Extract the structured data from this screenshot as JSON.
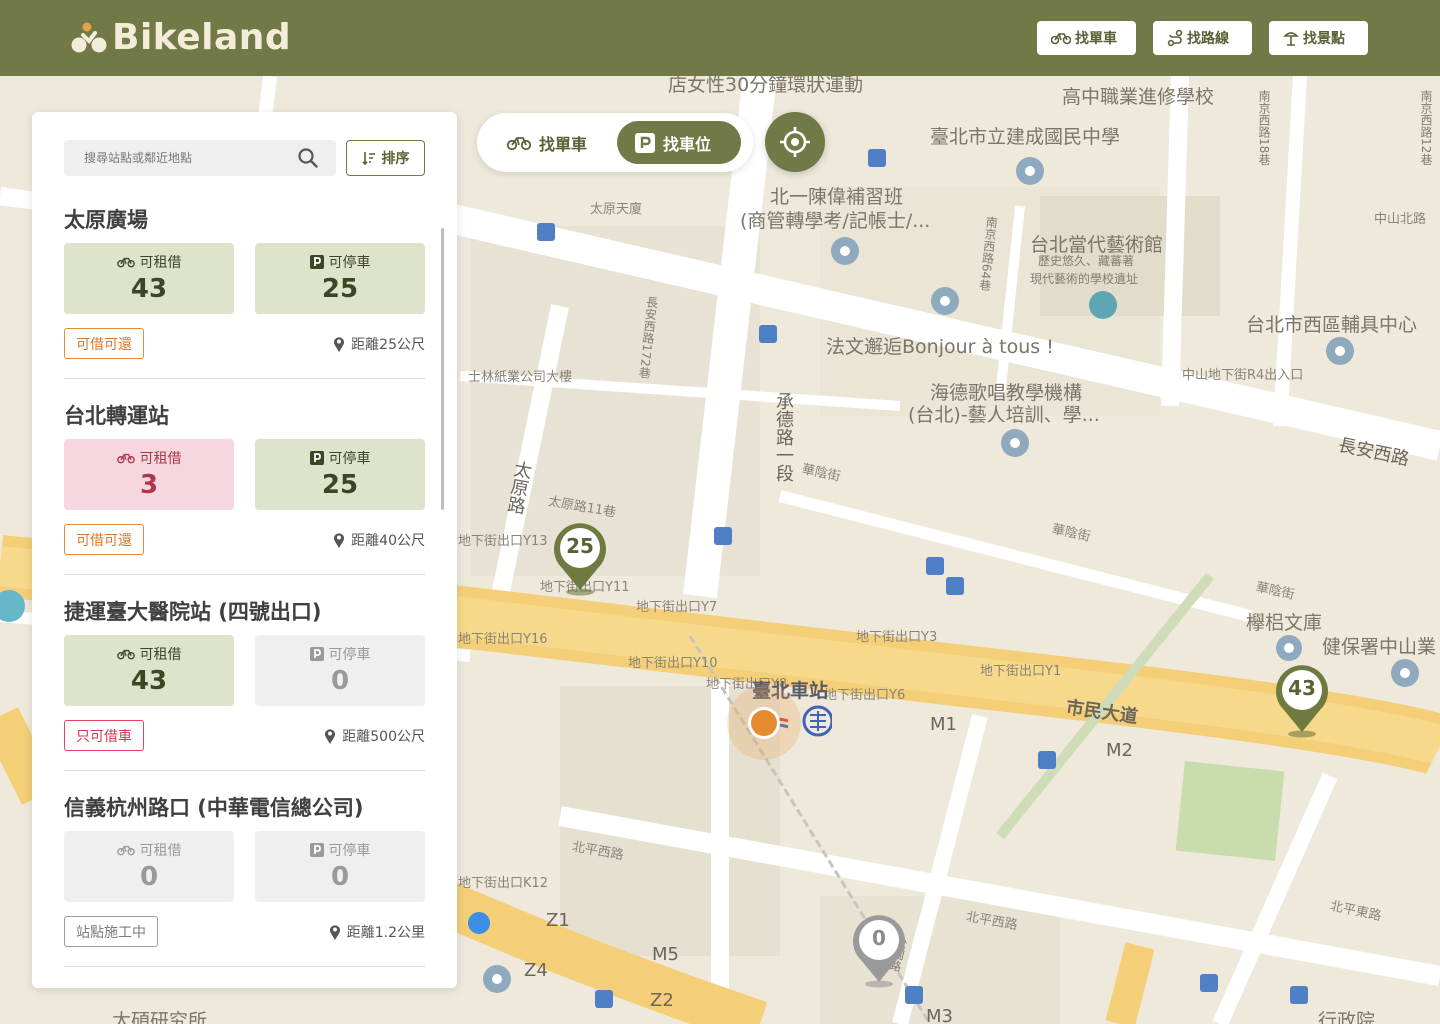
{
  "app": {
    "logo_text": "Bikeland",
    "nav": [
      {
        "label": "找單車",
        "icon": "bike-icon"
      },
      {
        "label": "找路線",
        "icon": "route-icon"
      },
      {
        "label": "找景點",
        "icon": "landmark-icon"
      }
    ]
  },
  "mode_toggle": {
    "options": [
      {
        "label": "找單車",
        "icon": "bike-icon",
        "active": false
      },
      {
        "label": "找車位",
        "icon": "parking-icon",
        "active": true
      }
    ],
    "locate_icon": "crosshair-icon"
  },
  "panel": {
    "search_placeholder": "搜尋站點或鄰近地點",
    "sort_label": "排序",
    "stations": [
      {
        "name": "太原廣場",
        "rent_label": "可租借",
        "rent": "43",
        "rent_state": "green",
        "park_label": "可停車",
        "park": "25",
        "park_state": "green",
        "tag": "可借可還",
        "tag_state": "orange",
        "distance": "距離25公尺"
      },
      {
        "name": "台北轉運站",
        "rent_label": "可租借",
        "rent": "3",
        "rent_state": "pink",
        "park_label": "可停車",
        "park": "25",
        "park_state": "green",
        "tag": "可借可還",
        "tag_state": "orange",
        "distance": "距離40公尺"
      },
      {
        "name": "捷運臺大醫院站 (四號出口)",
        "rent_label": "可租借",
        "rent": "43",
        "rent_state": "green",
        "park_label": "可停車",
        "park": "0",
        "park_state": "gray",
        "tag": "只可借車",
        "tag_state": "red",
        "distance": "距離500公尺"
      },
      {
        "name": "信義杭州路口 (中華電信總公司)",
        "rent_label": "可租借",
        "rent": "0",
        "rent_state": "gray",
        "park_label": "可停車",
        "park": "0",
        "park_state": "gray",
        "tag": "站點施工中",
        "tag_state": "gray",
        "distance": "距離1.2公里"
      }
    ]
  },
  "map": {
    "pins": [
      {
        "value": "25",
        "state": "green"
      },
      {
        "value": "43",
        "state": "green"
      },
      {
        "value": "0",
        "state": "gray"
      }
    ],
    "station_name": "臺北車站",
    "labels": {
      "l1": "店女性30分鐘環狀運動",
      "l2": "高中職業進修學校",
      "l3": "臺北市立建成國民中學",
      "l4": "北一陳偉補習班",
      "l5": "(商管轉學考/記帳士/...",
      "l6": "太原天廈",
      "l7": "台北當代藝術館",
      "l8": "歷史悠久、藏蕃著",
      "l9": "現代藝術的學校遺址",
      "l10": "法文邂逅Bonjour à tous !",
      "l11": "台北市西區輔具中心",
      "l12": "士林紙業公司大樓",
      "l13": "海德歌唱教學機構",
      "l14": "(台北)-藝人培訓、學...",
      "l15": "中山地下街R4出入口",
      "l16": "長安西路",
      "l17": "承德路一段",
      "l18": "華陰街",
      "l19": "華陰街",
      "l20": "太原路",
      "l21": "太原路11巷",
      "l22": "地下街出口Y13",
      "l23": "地下街出口Y11",
      "l24": "地下街出口Y7",
      "l25": "地下街出口Y16",
      "l26": "地下街出口Y10",
      "l27": "地下街出口Y8",
      "l28": "地下街出口Y6",
      "l29": "地下街出口Y3",
      "l30": "地下街出口Y1",
      "l31": "市民大道",
      "l32": "M1",
      "l33": "M2",
      "l34": "欅梠文庫",
      "l35": "健保署中山業",
      "l36": "北平西路",
      "l37": "北平西路",
      "l38": "北平東路",
      "l39": "地下街出口K12",
      "l40": "Z1",
      "l41": "Z4",
      "l42": "Z2",
      "l43": "M5",
      "l44": "M3",
      "l45": "太碩研究所",
      "l46": "中山北路",
      "l47": "長安西路172巷",
      "l48": "南京西路64巷",
      "l49": "南京西路18巷",
      "l50": "南京西路12巷",
      "l51": "行政院",
      "l52": "華陰街",
      "l53": "公園路"
    }
  }
}
